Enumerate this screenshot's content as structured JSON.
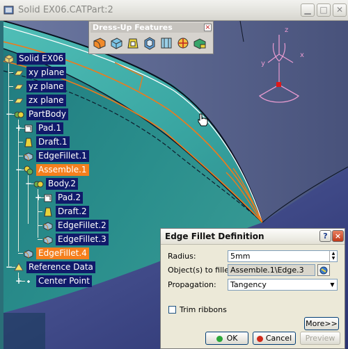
{
  "window": {
    "title": "Solid EX06.CATPart:2",
    "minimize_icon": "minimize-icon",
    "maximize_icon": "maximize-icon",
    "close_icon": "close-icon"
  },
  "toolbar": {
    "title": "Dress-Up Features",
    "close_label": "×",
    "tools": [
      "fillet-icon",
      "chamfer-icon",
      "draft-icon",
      "shell-icon",
      "thickness-icon",
      "thread-icon",
      "remove-face-icon"
    ]
  },
  "tree": {
    "root": "Solid EX06",
    "items": [
      {
        "label": "xy plane",
        "icon": "plane-icon"
      },
      {
        "label": "yz plane",
        "icon": "plane-icon"
      },
      {
        "label": "zx plane",
        "icon": "plane-icon"
      },
      {
        "label": "PartBody",
        "icon": "body-icon"
      },
      {
        "label": "Pad.1",
        "icon": "pad-icon"
      },
      {
        "label": "Draft.1",
        "icon": "draft-icon"
      },
      {
        "label": "EdgeFillet.1",
        "icon": "edge-fillet-icon"
      },
      {
        "label": "Assemble.1",
        "icon": "assemble-icon"
      },
      {
        "label": "Body.2",
        "icon": "body-icon"
      },
      {
        "label": "Pad.2",
        "icon": "pad-icon"
      },
      {
        "label": "Draft.2",
        "icon": "draft-icon"
      },
      {
        "label": "EdgeFillet.2",
        "icon": "edge-fillet-icon"
      },
      {
        "label": "EdgeFillet.3",
        "icon": "edge-fillet-icon"
      },
      {
        "label": "EdgeFillet.4",
        "icon": "edge-fillet-icon"
      },
      {
        "label": "Reference Data",
        "icon": "reference-icon"
      },
      {
        "label": "Center Point",
        "icon": "point-icon"
      }
    ],
    "colors": {
      "label_bg": "#101a6a",
      "highlight_bg": "#f57f1d"
    }
  },
  "compass": {
    "axis_x": "x",
    "axis_y": "y",
    "axis_z": "z"
  },
  "dialog": {
    "title": "Edge Fillet Definition",
    "help_label": "?",
    "close_label": "×",
    "radius_label": "Radius:",
    "radius_value": "5mm",
    "objects_label": "Object(s) to fillet:",
    "objects_value": "Assemble.1\\Edge.3",
    "propagation_label": "Propagation:",
    "propagation_value": "Tangency",
    "trim_label": "Trim ribbons",
    "trim_checked": false,
    "more_label": "More>>",
    "ok_label": "OK",
    "cancel_label": "Cancel",
    "preview_label": "Preview"
  }
}
